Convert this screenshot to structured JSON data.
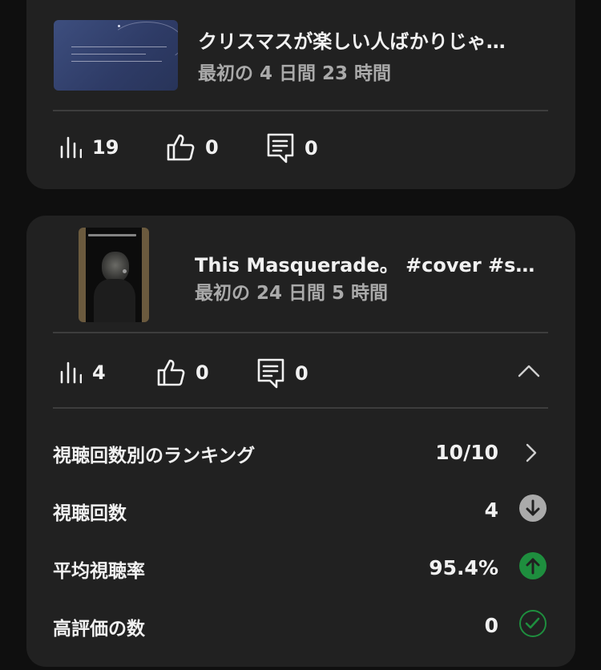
{
  "videos": [
    {
      "title": "クリスマスが楽しい人ばかりじゃ…",
      "subtitle": "最初の 4 日間 23 時間",
      "thumbnail_lines": [
        "愛ということばの意味をずっと忘れてた",
        "自分が何か無くした時",
        "愛するひとは遠い世界へと去っていった"
      ],
      "views": "19",
      "likes": "0",
      "comments": "0"
    },
    {
      "title": "This Masquerade。 #cover #sh…",
      "subtitle": "最初の 24 日間 5 時間",
      "thumbnail_caption": "This Masquerade",
      "views": "4",
      "likes": "0",
      "comments": "0",
      "expanded": true,
      "details": [
        {
          "label": "視聴回数別のランキング",
          "value": "10/10",
          "indicator": "chevron-right"
        },
        {
          "label": "視聴回数",
          "value": "4",
          "indicator": "arrow-down",
          "color": "#aaaaaa"
        },
        {
          "label": "平均視聴率",
          "value": "95.4%",
          "indicator": "arrow-up",
          "color": "#1e8e3e"
        },
        {
          "label": "高評価の数",
          "value": "0",
          "indicator": "check",
          "color": "#1e8e3e"
        }
      ]
    }
  ],
  "icons": {
    "views": "bar-chart-icon",
    "likes": "thumb-up-icon",
    "comments": "comment-icon",
    "collapse": "chevron-up-icon"
  }
}
